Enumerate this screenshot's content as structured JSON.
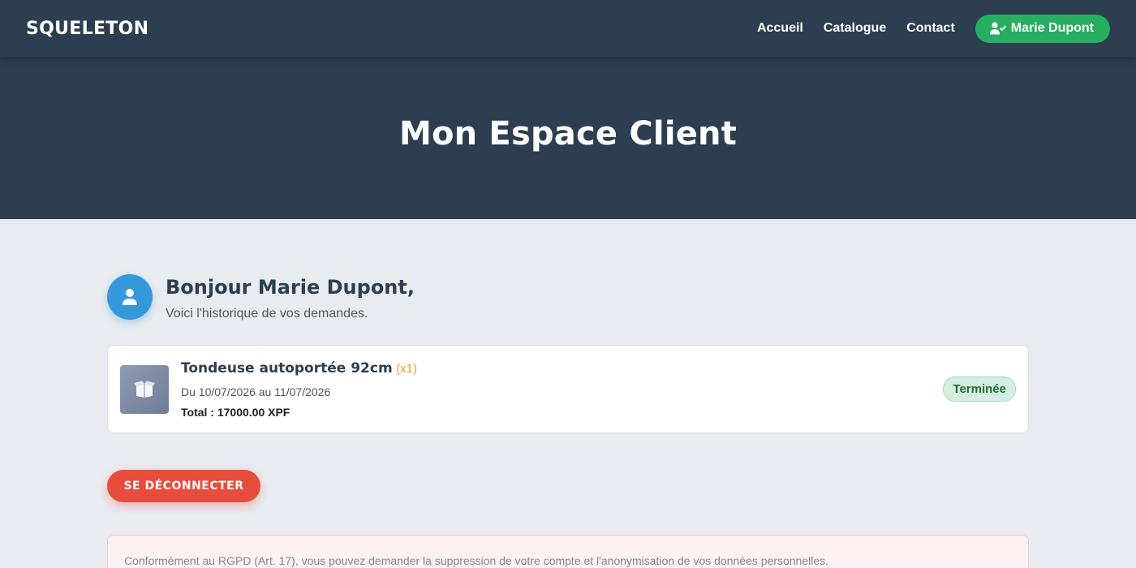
{
  "brand": {
    "logo": "SQUELETON"
  },
  "nav": {
    "links": [
      "Accueil",
      "Catalogue",
      "Contact"
    ],
    "user_label": "Marie Dupont"
  },
  "hero": {
    "title": "Mon Espace Client"
  },
  "greeting": {
    "title": "Bonjour Marie Dupont,",
    "subtitle": "Voici l'historique de vos demandes."
  },
  "orders": [
    {
      "product": "Tondeuse autoportée 92cm",
      "quantity": "(x1)",
      "dates": "Du 10/07/2026 au 11/07/2026",
      "total": "Total : 17000.00 XPF",
      "status": "Terminée"
    }
  ],
  "actions": {
    "logout": "SE DÉCONNECTER"
  },
  "rgpd": {
    "text": "Conformément au RGPD (Art. 17), vous pouvez demander la suppression de votre compte et l'anonymisation de vos données personnelles."
  },
  "colors": {
    "primary": "#2c3e50",
    "accent_green": "#27ae60",
    "accent_blue": "#3498db",
    "danger": "#e74c3c",
    "quantity": "#f39c12"
  }
}
